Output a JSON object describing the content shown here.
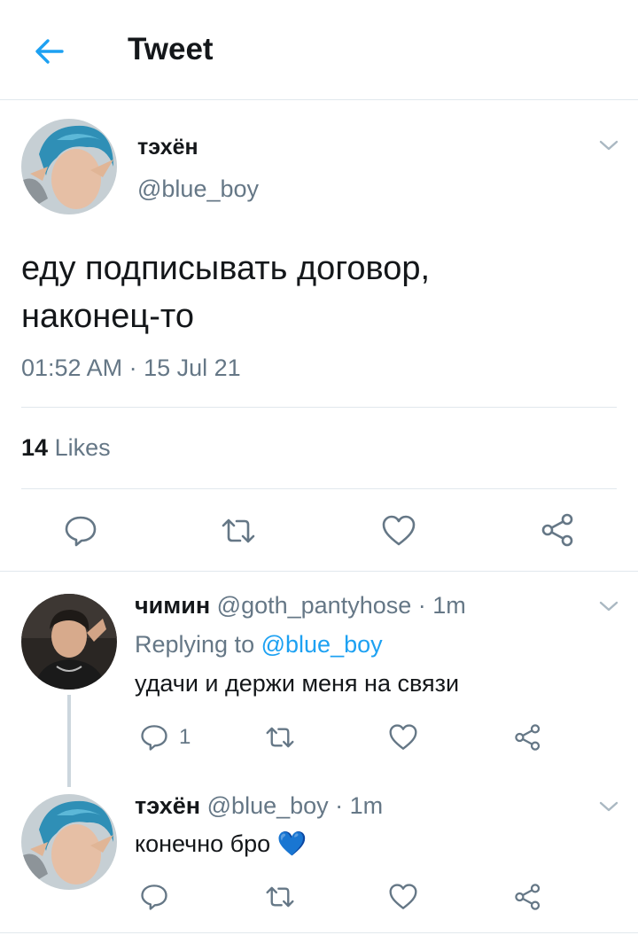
{
  "header": {
    "title": "Tweet",
    "back_icon": "arrow-left-icon"
  },
  "main_tweet": {
    "display_name": "тэхён",
    "handle": "@blue_boy",
    "text_line1": "еду подписывать договор,",
    "text_line2": "наконец-то",
    "timestamp": "01:52 AM · 15 Jul 21",
    "likes_count": "14",
    "likes_label": "Likes",
    "actions": [
      "reply-icon",
      "retweet-icon",
      "heart-icon",
      "share-icon"
    ]
  },
  "replies": [
    {
      "display_name": "чимин",
      "handle": "@goth_pantyhose",
      "time": "· 1m",
      "replying_prefix": "Replying to",
      "replying_handle": "@blue_boy",
      "text": "удачи и держи меня на связи",
      "reply_count": "1"
    },
    {
      "display_name": "тэхён",
      "handle": "@blue_boy",
      "time": "· 1m",
      "text": "конечно бро",
      "emoji": "💙"
    }
  ],
  "colors": {
    "accent": "#1da1f2",
    "text": "#14171a",
    "secondary": "#657786",
    "divider": "#e1e8ed"
  }
}
